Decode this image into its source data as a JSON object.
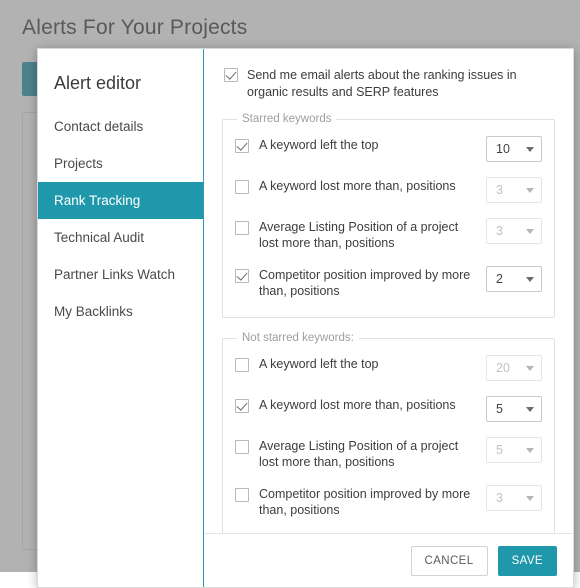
{
  "page": {
    "title": "Alerts For Your Projects",
    "add_button_label": "+"
  },
  "modal": {
    "heading": "Alert editor",
    "nav": [
      {
        "label": "Contact details",
        "active": false
      },
      {
        "label": "Projects",
        "active": false
      },
      {
        "label": "Rank Tracking",
        "active": true
      },
      {
        "label": "Technical Audit",
        "active": false
      },
      {
        "label": "Partner Links Watch",
        "active": false
      },
      {
        "label": "My Backlinks",
        "active": false
      }
    ],
    "master_option": {
      "label": "Send me email alerts about the ranking issues in organic results and SERP features",
      "checked": true
    },
    "groups": [
      {
        "legend": "Starred keywords",
        "options": [
          {
            "label": "A keyword left the top",
            "checked": true,
            "value": "10",
            "enabled": true
          },
          {
            "label": "A keyword lost more than, positions",
            "checked": false,
            "value": "3",
            "enabled": false
          },
          {
            "label": "Average Listing Position of a project lost more than, positions",
            "checked": false,
            "value": "3",
            "enabled": false
          },
          {
            "label": "Competitor position improved by more than, positions",
            "checked": true,
            "value": "2",
            "enabled": true
          }
        ]
      },
      {
        "legend": "Not starred keywords:",
        "options": [
          {
            "label": "A keyword left the top",
            "checked": false,
            "value": "20",
            "enabled": false
          },
          {
            "label": "A keyword lost more than, positions",
            "checked": true,
            "value": "5",
            "enabled": true
          },
          {
            "label": "Average Listing Position of a project lost more than, positions",
            "checked": false,
            "value": "5",
            "enabled": false
          },
          {
            "label": "Competitor position improved by more than, positions",
            "checked": false,
            "value": "3",
            "enabled": false
          }
        ]
      }
    ],
    "footer": {
      "cancel_label": "CANCEL",
      "save_label": "SAVE"
    }
  },
  "colors": {
    "accent": "#2098ac",
    "overlay": "#737373",
    "text": "#3d3d3d",
    "muted": "#9e9e9e"
  }
}
